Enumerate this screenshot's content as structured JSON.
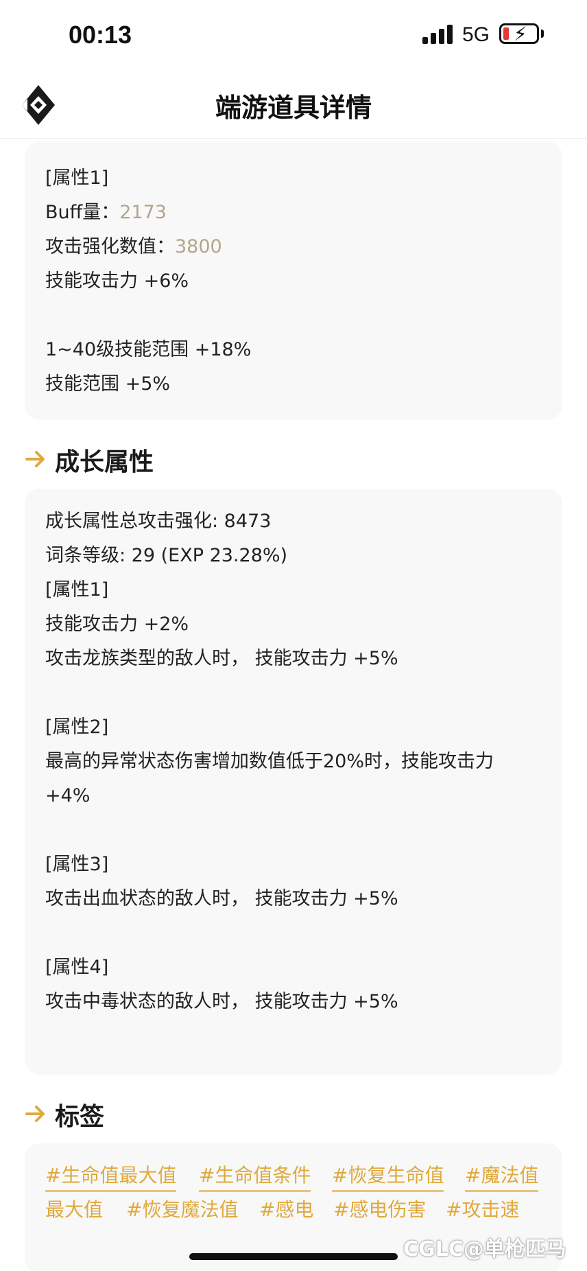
{
  "status_bar": {
    "time": "00:13",
    "network": "5G"
  },
  "header": {
    "title": "端游道具详情"
  },
  "card1": {
    "lines": [
      {
        "label": "[属性1]"
      },
      {
        "label": "Buff量：",
        "value": "2173"
      },
      {
        "label": "攻击强化数值：",
        "value": "3800"
      },
      {
        "label": "技能攻击力 +6%"
      },
      {
        "label": "1~40级技能范围 +18%"
      },
      {
        "label": "技能范围 +5%"
      }
    ]
  },
  "growth": {
    "heading": "成长属性",
    "lines": [
      "成长属性总攻击强化: 8473",
      "词条等级: 29 (EXP 23.28%)",
      "[属性1]",
      "技能攻击力 +2%",
      "攻击龙族类型的敌人时， 技能攻击力 +5%",
      "[属性2]",
      "最高的异常状态伤害增加数值低于20%时，技能攻击力",
      "+4%",
      "[属性3]",
      "攻击出血状态的敌人时， 技能攻击力 +5%",
      "[属性4]",
      "攻击中毒状态的敌人时， 技能攻击力 +5%"
    ]
  },
  "tags": {
    "heading": "标签",
    "items": [
      "#生命值最大值",
      "#生命值条件",
      "#恢复生命值",
      "#魔法值",
      "最大值",
      "#恢复魔法值",
      "#感电",
      "#感电伤害",
      "#攻击速"
    ]
  },
  "watermark": "CGLC@单枪匹马",
  "colors": {
    "accent": "#e0a93d",
    "value_text": "#b3a58c",
    "card_bg": "#f8f8f8"
  }
}
